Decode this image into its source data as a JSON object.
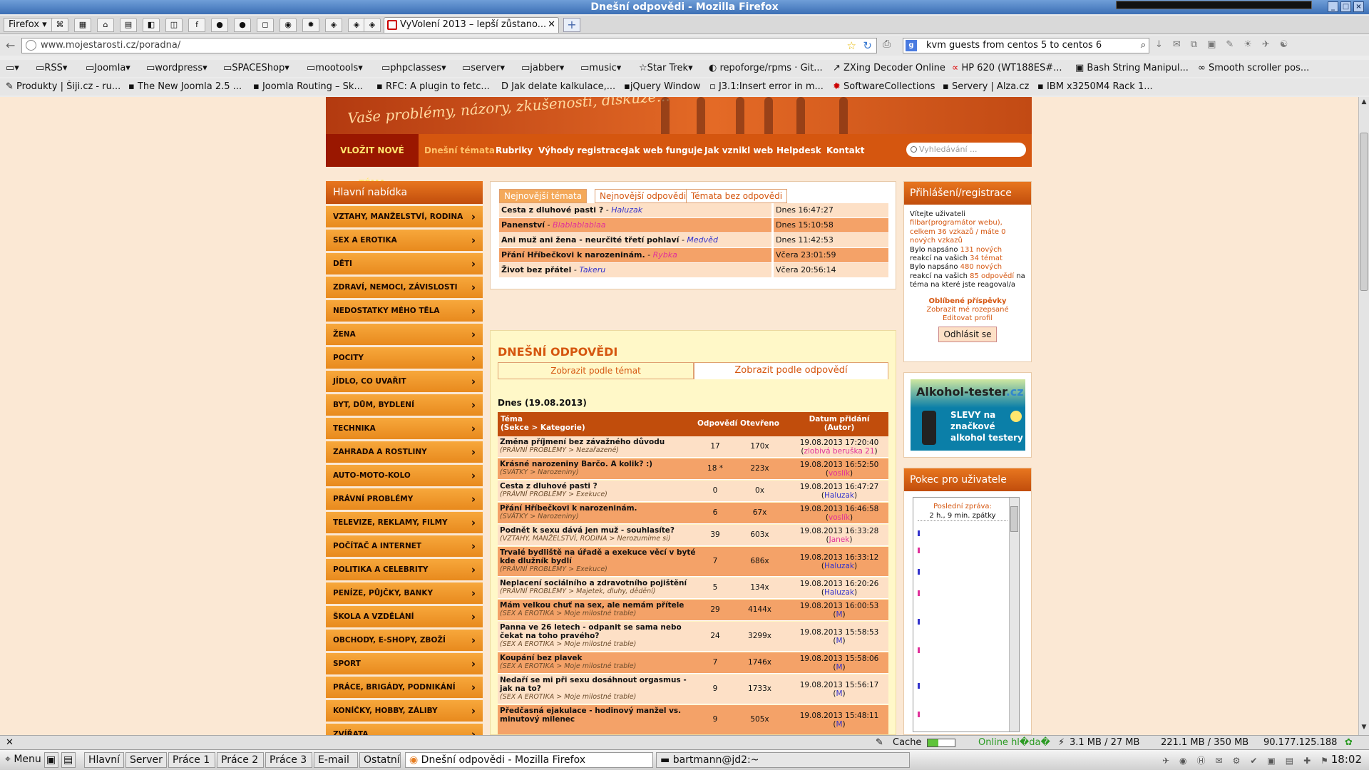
{
  "window": {
    "title": "Dnešní odpovědi - Mozilla Firefox"
  },
  "tabs": {
    "firefox_menu": "Firefox",
    "active_tab": "VyVolení 2013 – lepší zůstano...",
    "new_tab": "+"
  },
  "nav": {
    "url": "www.mojestarosti.cz/poradna/",
    "search": "kvm guests from centos 5 to centos 6",
    "search_engine": "g"
  },
  "bookmarks1": [
    {
      "label": "RSS"
    },
    {
      "label": "Joomla"
    },
    {
      "label": "wordpress"
    },
    {
      "label": "SPACEShop"
    },
    {
      "label": "mootools"
    },
    {
      "label": "phpclasses"
    },
    {
      "label": "server"
    },
    {
      "label": "jabber"
    },
    {
      "label": "music"
    },
    {
      "label": "Star Trek"
    },
    {
      "label": "repoforge/rpms · Git..."
    },
    {
      "label": "ZXing Decoder Online"
    },
    {
      "label": "HP 620 (WT188ES#..."
    },
    {
      "label": "Bash String Manipul..."
    },
    {
      "label": "Smooth scroller pos..."
    }
  ],
  "bookmarks2": [
    {
      "label": "Produkty | Šiji.cz - ru..."
    },
    {
      "label": "The New Joomla 2.5 ..."
    },
    {
      "label": "Joomla Routing – Sk..."
    },
    {
      "label": "RFC: A plugin to fetc..."
    },
    {
      "label": "Jak delate kalkulace,..."
    },
    {
      "label": "jQuery Window"
    },
    {
      "label": "J3.1:Insert error in m..."
    },
    {
      "label": "SoftwareCollections"
    },
    {
      "label": "Servery | Alza.cz"
    },
    {
      "label": "IBM x3250M4 Rack 1..."
    }
  ],
  "site": {
    "banner_text": "Vaše problémy, názory, zkušenosti, diskuze...",
    "nav": {
      "new_topic": "VLOŽIT NOVÉ TÉMA",
      "items": [
        {
          "label": "Dnešní témata"
        },
        {
          "label": "Rubriky"
        },
        {
          "label": "Výhody registrace"
        },
        {
          "label": "Jak web funguje"
        },
        {
          "label": "Jak vznikl web"
        },
        {
          "label": "Helpdesk"
        },
        {
          "label": "Kontakt"
        }
      ],
      "search_placeholder": "Vyhledávání ..."
    },
    "sidebar": {
      "title": "Hlavní nabídka",
      "items": [
        {
          "label": "VZTAHY, MANŽELSTVÍ, RODINA"
        },
        {
          "label": "SEX A EROTIKA"
        },
        {
          "label": "DĚTI"
        },
        {
          "label": "ZDRAVÍ, NEMOCI, ZÁVISLOSTI"
        },
        {
          "label": "NEDOSTATKY MÉHO TĚLA"
        },
        {
          "label": "ŽENA"
        },
        {
          "label": "POCITY"
        },
        {
          "label": "JÍDLO, CO UVAŘIT"
        },
        {
          "label": "BYT, DŮM, BYDLENÍ"
        },
        {
          "label": "TECHNIKA"
        },
        {
          "label": "ZAHRADA A ROSTLINY"
        },
        {
          "label": "AUTO-MOTO-KOLO"
        },
        {
          "label": "PRÁVNÍ PROBLÉMY"
        },
        {
          "label": "TELEVIZE, REKLAMY, FILMY"
        },
        {
          "label": "POČÍTAČ A INTERNET"
        },
        {
          "label": "POLITIKA A CELEBRITY"
        },
        {
          "label": "PENÍZE, PŮJČKY, BANKY"
        },
        {
          "label": "ŠKOLA A VZDĚLÁNÍ"
        },
        {
          "label": "OBCHODY, E-SHOPY, ZBOŽÍ"
        },
        {
          "label": "SPORT"
        },
        {
          "label": "PRÁCE, BRIGÁDY, PODNIKÁNÍ"
        },
        {
          "label": "KONÍČKY, HOBBY, ZÁLIBY"
        },
        {
          "label": "ZVÍŘATA"
        }
      ]
    },
    "newest": {
      "tabs": [
        {
          "label": "Nejnovější témata"
        },
        {
          "label": "Nejnovější odpovědi"
        },
        {
          "label": "Témata bez odpovědi"
        }
      ],
      "rows": [
        {
          "title": "Cesta z dluhové pasti ?",
          "sep": " - ",
          "author": "Haluzak",
          "author_color": "#3333cc",
          "date": "Dnes 16:47:27"
        },
        {
          "title": "Panenství",
          "sep": " - ",
          "author": "Blablablablaa",
          "author_color": "#e0309a",
          "date": "Dnes 15:10:58"
        },
        {
          "title": "Ani muž ani žena - neurčité třetí pohlaví",
          "sep": " - ",
          "author": "Medvěd",
          "author_color": "#3333cc",
          "date": "Dnes 11:42:53"
        },
        {
          "title": "Přání Hříbečkovi k narozeninám.",
          "sep": " - ",
          "author": "Rybka",
          "author_color": "#e0309a",
          "date": "Včera 23:01:59"
        },
        {
          "title": "Život bez přátel",
          "sep": " - ",
          "author": "Takeru",
          "author_color": "#3333cc",
          "date": "Včera 20:56:14"
        }
      ]
    },
    "today": {
      "title": "DNEŠNÍ ODPOVĚDI",
      "toggle_topics": "Zobrazit podle témat",
      "toggle_answers": "Zobrazit podle odpovědí",
      "date": "Dnes (19.08.2013)",
      "head": {
        "topic": "Téma",
        "topic_sub": "(Sekce > Kategorie)",
        "answers": "Odpovědí",
        "opened": "Otevřeno",
        "date": "Datum přidání",
        "author": "(Autor)"
      },
      "rows": [
        {
          "t": "Změna příjmení bez závažného důvodu",
          "c": "(PRÁVNÍ PROBLÉMY > Nezařazené)",
          "a": "17",
          "o": "170x",
          "d": "19.08.2013 17:20:40",
          "u": "zlobivá beruška 21",
          "uc": "#e0309a"
        },
        {
          "t": "Krásné narozeniny Barčo. A kolik? :)",
          "c": "(SVÁTKY > Narozeniny)",
          "a": "18 *",
          "o": "223x",
          "d": "19.08.2013 16:52:50",
          "u": "voslík",
          "uc": "#e0309a"
        },
        {
          "t": "Cesta z dluhové pasti ?",
          "c": "(PRÁVNÍ PROBLÉMY > Exekuce)",
          "a": "0",
          "o": "0x",
          "d": "19.08.2013 16:47:27",
          "u": "Haluzak",
          "uc": "#3333cc"
        },
        {
          "t": "Přání Hříbečkovi k narozeninám.",
          "c": "(SVÁTKY > Narozeniny)",
          "a": "6",
          "o": "67x",
          "d": "19.08.2013 16:46:58",
          "u": "voslík",
          "uc": "#e0309a"
        },
        {
          "t": "Podnět k sexu dává jen muž - souhlasíte?",
          "c": "(VZTAHY, MANŽELSTVÍ, RODINA > Nerozumíme si)",
          "a": "39",
          "o": "603x",
          "d": "19.08.2013 16:33:28",
          "u": "Janek",
          "uc": "#e0309a"
        },
        {
          "t": "Trvalé bydliště na úřadě a exekuce věcí v byté kde dlužník bydlí",
          "c": "(PRÁVNÍ PROBLÉMY > Exekuce)",
          "a": "7",
          "o": "686x",
          "d": "19.08.2013 16:33:12",
          "u": "Haluzak",
          "uc": "#3333cc"
        },
        {
          "t": "Neplacení sociálního a zdravotního pojištění",
          "c": "(PRÁVNÍ PROBLÉMY > Majetek, dluhy, dědění)",
          "a": "5",
          "o": "134x",
          "d": "19.08.2013 16:20:26",
          "u": "Haluzak",
          "uc": "#3333cc"
        },
        {
          "t": "Mám velkou chuť na sex, ale nemám přítele",
          "c": "(SEX A EROTIKA > Moje milostné trable)",
          "a": "29",
          "o": "4144x",
          "d": "19.08.2013 16:00:53",
          "u": "M",
          "uc": "#3333cc"
        },
        {
          "t": "Panna ve 26 letech - odpanit se sama nebo čekat na toho pravého?",
          "c": "(SEX A EROTIKA > Moje milostné trable)",
          "a": "24",
          "o": "3299x",
          "d": "19.08.2013 15:58:53",
          "u": "M",
          "uc": "#3333cc"
        },
        {
          "t": "Koupání bez plavek",
          "c": "(SEX A EROTIKA > Moje milostné trable)",
          "a": "7",
          "o": "1746x",
          "d": "19.08.2013 15:58:06",
          "u": "M",
          "uc": "#3333cc"
        },
        {
          "t": "Nedaří se mi při sexu dosáhnout orgasmus - jak na to?",
          "c": "(SEX A EROTIKA > Moje milostné trable)",
          "a": "9",
          "o": "1733x",
          "d": "19.08.2013 15:56:17",
          "u": "M",
          "uc": "#3333cc"
        },
        {
          "t": "Předčasná ejakulace - hodinový manžel vs. minutový milenec",
          "c": "",
          "a": "9",
          "o": "505x",
          "d": "19.08.2013 15:48:11",
          "u": "M",
          "uc": "#3333cc"
        }
      ]
    },
    "login": {
      "title": "Přihlášení/registrace",
      "welcome": "Vítejte uživateli",
      "user": "filbar(programátor webu),",
      "messages": "celkem 36 vzkazů / máte 0 nových vzkazů",
      "line1a": "Bylo napsáno ",
      "line1n": "131 nových",
      "line1b": " reakcí na vašich ",
      "line1m": "34 témat",
      "line2a": "Bylo napsáno ",
      "line2n": "480 nových",
      "line2b": " reakcí na vašich ",
      "line2m": "85 odpovědí",
      "line2c": " na téma na které jste reagoval/a",
      "fav": "Oblíbené příspěvky",
      "unread": "Zobrazit mé rozepsané",
      "edit": "Editovat profil",
      "logout": "Odhlásit se"
    },
    "ad": {
      "logo": "Alkohol-tester",
      "logo_tld": ".cz",
      "text1": "SLEVY na",
      "text2": "značkové",
      "text3": "alkohol testery"
    },
    "chat": {
      "title": "Pokec pro uživatele",
      "last": "Poslední zpráva:",
      "ago": "2 h., 9 min. zpátky"
    }
  },
  "status": {
    "cache": "Cache",
    "online": "Online hl�da�",
    "mem1": "3.1 MB / 27 MB",
    "mem2": "221.1 MB / 350 MB",
    "ip": "90.177.125.188"
  },
  "taskbar": {
    "menu": "Menu",
    "items": [
      {
        "label": "Hlavní"
      },
      {
        "label": "Server"
      },
      {
        "label": "Práce 1"
      },
      {
        "label": "Práce 2"
      },
      {
        "label": "Práce 3"
      },
      {
        "label": "E-mail"
      },
      {
        "label": "Ostatní"
      }
    ],
    "window1": "Dnešní odpovědi - Mozilla Firefox",
    "window2": "bartmann@jd2:~",
    "clock": "18:02"
  }
}
